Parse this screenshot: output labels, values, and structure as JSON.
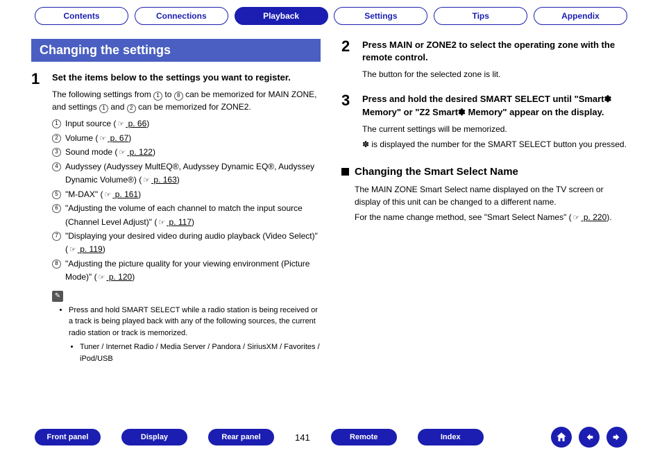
{
  "tabs": {
    "contents": "Contents",
    "connections": "Connections",
    "playback": "Playback",
    "settings": "Settings",
    "tips": "Tips",
    "appendix": "Appendix"
  },
  "section_title": "Changing the settings",
  "step1": {
    "num": "1",
    "title": "Set the items below to the settings you want to register.",
    "intro_a": "The following settings from ",
    "intro_b": " to ",
    "intro_c": " can be memorized for MAIN ZONE, and settings ",
    "intro_d": " and ",
    "intro_e": " can be memorized for ZONE2.",
    "c1": "1",
    "c8": "8",
    "c1b": "1",
    "c2b": "2"
  },
  "settings_list": [
    {
      "n": "1",
      "text": "Input source  (",
      "link": " p. 66",
      "after": ")"
    },
    {
      "n": "2",
      "text": "Volume  (",
      "link": " p. 67",
      "after": ")"
    },
    {
      "n": "3",
      "text": "Sound mode  (",
      "link": " p. 122",
      "after": ")"
    },
    {
      "n": "4",
      "text": "Audyssey (Audyssey MultEQ®, Audyssey Dynamic EQ®, Audyssey Dynamic Volume®)  (",
      "link": " p. 163",
      "after": ")"
    },
    {
      "n": "5",
      "text": "\"M-DAX\" (",
      "link": " p. 161",
      "after": ")"
    },
    {
      "n": "6",
      "text": "\"Adjusting the volume of each channel to match the input source (Channel Level Adjust)\" (",
      "link": " p. 117",
      "after": ")"
    },
    {
      "n": "7",
      "text": "\"Displaying your desired video during audio playback (Video Select)\" (",
      "link": " p. 119",
      "after": ")"
    },
    {
      "n": "8",
      "text": "\"Adjusting the picture quality for your viewing environment (Picture Mode)\" (",
      "link": " p. 120",
      "after": ")"
    }
  ],
  "note1": "Press and hold SMART SELECT while a radio station is being received or a track is being played back with any of the following sources, the current radio station or track is memorized.",
  "note2": "Tuner / Internet Radio / Media Server / Pandora / SiriusXM / Favorites / iPod/USB",
  "step2": {
    "num": "2",
    "title": "Press MAIN or ZONE2 to select the operating zone with the remote control.",
    "text": "The button for the selected zone is lit."
  },
  "step3": {
    "num": "3",
    "title": "Press and hold the desired SMART SELECT until \"Smart✽ Memory\" or \"Z2 Smart✽ Memory\" appear on the display.",
    "text1": "The current settings will be memorized.",
    "text2": "✽ is displayed the number for the SMART SELECT button you pressed."
  },
  "sub": {
    "title": "Changing the Smart Select Name",
    "p1": "The MAIN ZONE Smart Select name displayed on the TV screen or display of this unit can be changed to a different name.",
    "p2a": "For the name change method, see \"Smart Select Names\" (",
    "p2link": " p. 220",
    "p2b": ")."
  },
  "bottom": {
    "front": "Front panel",
    "display": "Display",
    "rear": "Rear panel",
    "remote": "Remote",
    "index": "Index",
    "page": "141"
  }
}
